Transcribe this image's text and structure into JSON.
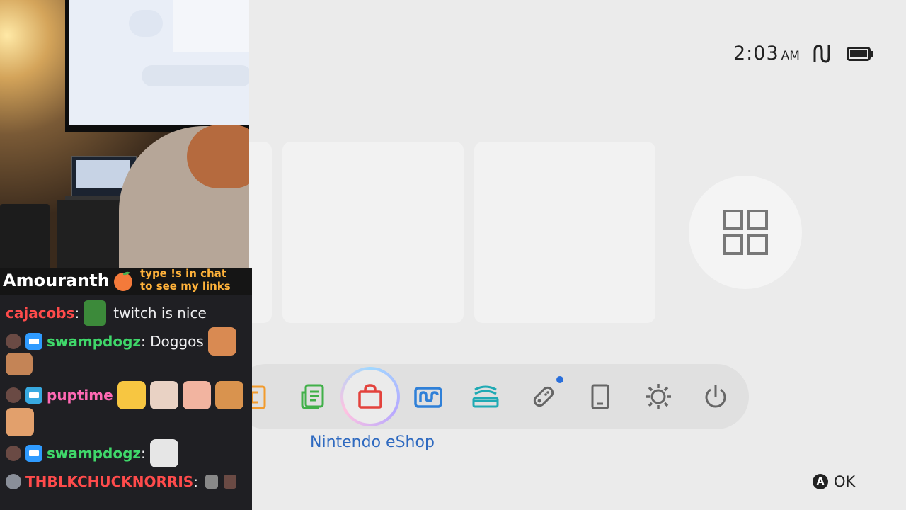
{
  "status_bar": {
    "time": "2:03",
    "ampm": "AM"
  },
  "dock": {
    "selected_label": "Nintendo eShop",
    "items": [
      {
        "name": "album-icon",
        "color": "#f29b2d"
      },
      {
        "name": "news-icon",
        "color": "#41b049"
      },
      {
        "name": "eshop-icon",
        "color": "#e3423c"
      },
      {
        "name": "gallery-icon",
        "color": "#2f80d8"
      },
      {
        "name": "controllers-icon",
        "color": "#20aab4"
      },
      {
        "name": "joycon-icon",
        "color": "#666666"
      },
      {
        "name": "sleep-device-icon",
        "color": "#666666"
      },
      {
        "name": "settings-icon",
        "color": "#666666"
      },
      {
        "name": "power-icon",
        "color": "#666666"
      }
    ]
  },
  "hint": {
    "button": "A",
    "label": "OK"
  },
  "overlay": {
    "streamer": "Amouranth",
    "promo_line1": "type !s in chat",
    "promo_line2": "to see my links"
  },
  "chat": [
    {
      "user": "cajacobs",
      "color": "#ff4b4b",
      "text": "twitch is nice"
    },
    {
      "user": "swampdogz",
      "color": "#3fd86a",
      "text": "Doggos"
    },
    {
      "user": "puptime",
      "color": "#ff69b4",
      "text": ""
    },
    {
      "user": "swampdogz",
      "color": "#3fd86a",
      "text": ""
    },
    {
      "user": "THBLKCHUCKNORRIS",
      "color": "#ff4b4b",
      "text": ""
    }
  ]
}
